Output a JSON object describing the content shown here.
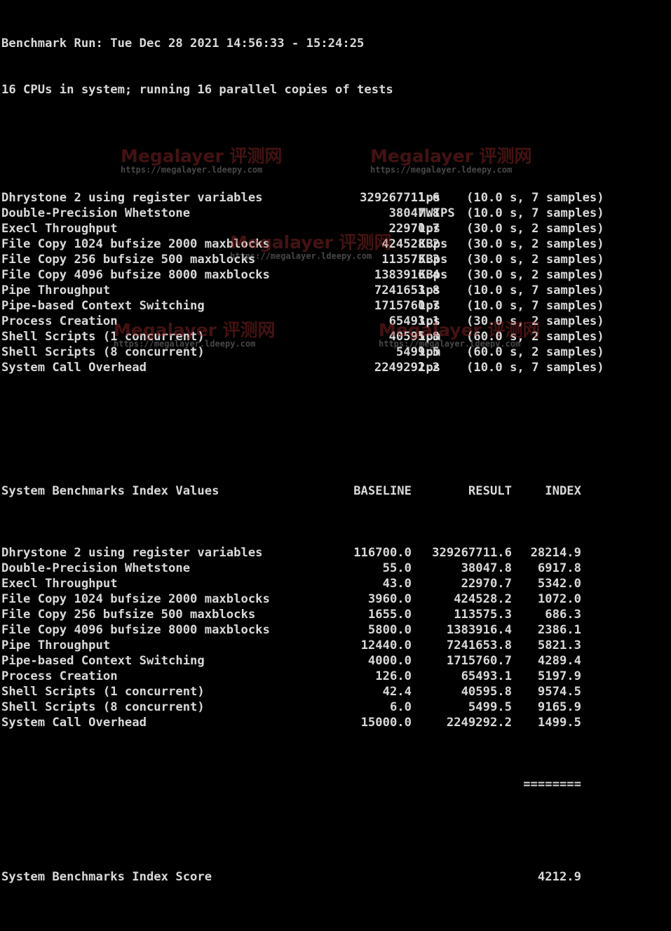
{
  "header": {
    "run_line": "Benchmark Run: Tue Dec 28 2021 14:56:33 - 15:24:25",
    "cpu_line": "16 CPUs in system; running 16 parallel copies of tests"
  },
  "results": [
    {
      "name": "Dhrystone 2 using register variables",
      "value": "329267711.6",
      "unit": "lps",
      "timing": "(10.0 s, 7 samples)"
    },
    {
      "name": "Double-Precision Whetstone",
      "value": "38047.8",
      "unit": "MWIPS",
      "timing": "(10.0 s, 7 samples)"
    },
    {
      "name": "Execl Throughput",
      "value": "22970.7",
      "unit": "lps",
      "timing": "(30.0 s, 2 samples)"
    },
    {
      "name": "File Copy 1024 bufsize 2000 maxblocks",
      "value": "424528.2",
      "unit": "KBps",
      "timing": "(30.0 s, 2 samples)"
    },
    {
      "name": "File Copy 256 bufsize 500 maxblocks",
      "value": "113575.3",
      "unit": "KBps",
      "timing": "(30.0 s, 2 samples)"
    },
    {
      "name": "File Copy 4096 bufsize 8000 maxblocks",
      "value": "1383916.4",
      "unit": "KBps",
      "timing": "(30.0 s, 2 samples)"
    },
    {
      "name": "Pipe Throughput",
      "value": "7241653.8",
      "unit": "lps",
      "timing": "(10.0 s, 7 samples)"
    },
    {
      "name": "Pipe-based Context Switching",
      "value": "1715760.7",
      "unit": "lps",
      "timing": "(10.0 s, 7 samples)"
    },
    {
      "name": "Process Creation",
      "value": "65493.1",
      "unit": "lps",
      "timing": "(30.0 s, 2 samples)"
    },
    {
      "name": "Shell Scripts (1 concurrent)",
      "value": "40595.8",
      "unit": "lpm",
      "timing": "(60.0 s, 2 samples)"
    },
    {
      "name": "Shell Scripts (8 concurrent)",
      "value": "5499.5",
      "unit": "lpm",
      "timing": "(60.0 s, 2 samples)"
    },
    {
      "name": "System Call Overhead",
      "value": "2249292.2",
      "unit": "lps",
      "timing": "(10.0 s, 7 samples)"
    }
  ],
  "index": {
    "title": "System Benchmarks Index Values",
    "col_baseline": "BASELINE",
    "col_result": "RESULT",
    "col_index": "INDEX",
    "rows": [
      {
        "name": "Dhrystone 2 using register variables",
        "baseline": "116700.0",
        "result": "329267711.6",
        "index": "28214.9"
      },
      {
        "name": "Double-Precision Whetstone",
        "baseline": "55.0",
        "result": "38047.8",
        "index": "6917.8"
      },
      {
        "name": "Execl Throughput",
        "baseline": "43.0",
        "result": "22970.7",
        "index": "5342.0"
      },
      {
        "name": "File Copy 1024 bufsize 2000 maxblocks",
        "baseline": "3960.0",
        "result": "424528.2",
        "index": "1072.0"
      },
      {
        "name": "File Copy 256 bufsize 500 maxblocks",
        "baseline": "1655.0",
        "result": "113575.3",
        "index": "686.3"
      },
      {
        "name": "File Copy 4096 bufsize 8000 maxblocks",
        "baseline": "5800.0",
        "result": "1383916.4",
        "index": "2386.1"
      },
      {
        "name": "Pipe Throughput",
        "baseline": "12440.0",
        "result": "7241653.8",
        "index": "5821.3"
      },
      {
        "name": "Pipe-based Context Switching",
        "baseline": "4000.0",
        "result": "1715760.7",
        "index": "4289.4"
      },
      {
        "name": "Process Creation",
        "baseline": "126.0",
        "result": "65493.1",
        "index": "5197.9"
      },
      {
        "name": "Shell Scripts (1 concurrent)",
        "baseline": "42.4",
        "result": "40595.8",
        "index": "9574.5"
      },
      {
        "name": "Shell Scripts (8 concurrent)",
        "baseline": "6.0",
        "result": "5499.5",
        "index": "9165.9"
      },
      {
        "name": "System Call Overhead",
        "baseline": "15000.0",
        "result": "2249292.2",
        "index": "1499.5"
      }
    ],
    "separator": "========",
    "score_label": "System Benchmarks Index Score",
    "score_value": "4212.9"
  },
  "watermark": {
    "title": "Megalayer 评测网",
    "url": "https://megalayer.ldeepy.com"
  },
  "colors": {
    "background": "#000000",
    "text": "#d9d9d9"
  }
}
